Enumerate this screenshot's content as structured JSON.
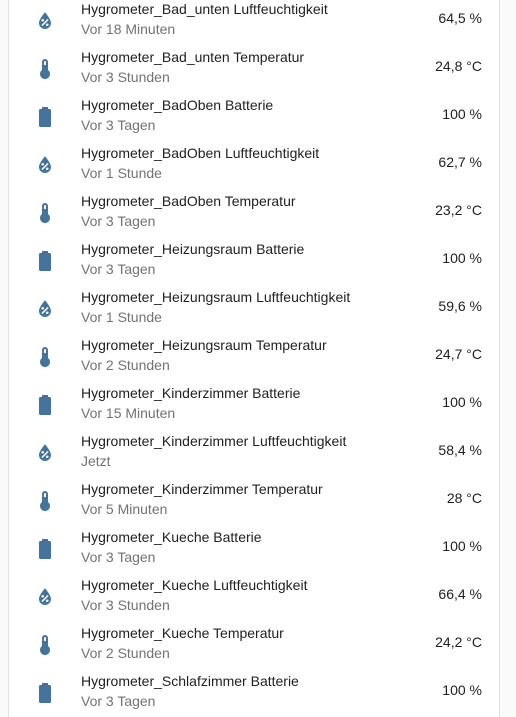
{
  "icon_color": "#44739e",
  "entities": [
    {
      "icon": "water-percent-icon",
      "name": "Hygrometer_Bad_unten Luftfeuchtigkeit",
      "time": "Vor 18 Minuten",
      "state": "64,5 %"
    },
    {
      "icon": "thermometer-icon",
      "name": "Hygrometer_Bad_unten Temperatur",
      "time": "Vor 3 Stunden",
      "state": "24,8 °C"
    },
    {
      "icon": "battery-icon",
      "name": "Hygrometer_BadOben Batterie",
      "time": "Vor 3 Tagen",
      "state": "100 %"
    },
    {
      "icon": "water-percent-icon",
      "name": "Hygrometer_BadOben Luftfeuchtigkeit",
      "time": "Vor 1 Stunde",
      "state": "62,7 %"
    },
    {
      "icon": "thermometer-icon",
      "name": "Hygrometer_BadOben Temperatur",
      "time": "Vor 3 Tagen",
      "state": "23,2 °C"
    },
    {
      "icon": "battery-icon",
      "name": "Hygrometer_Heizungsraum Batterie",
      "time": "Vor 3 Tagen",
      "state": "100 %"
    },
    {
      "icon": "water-percent-icon",
      "name": "Hygrometer_Heizungsraum Luftfeuchtigkeit",
      "time": "Vor 1 Stunde",
      "state": "59,6 %"
    },
    {
      "icon": "thermometer-icon",
      "name": "Hygrometer_Heizungsraum Temperatur",
      "time": "Vor 2 Stunden",
      "state": "24,7 °C"
    },
    {
      "icon": "battery-icon",
      "name": "Hygrometer_Kinderzimmer Batterie",
      "time": "Vor 15 Minuten",
      "state": "100 %"
    },
    {
      "icon": "water-percent-icon",
      "name": "Hygrometer_Kinderzimmer Luftfeuchtigkeit",
      "time": "Jetzt",
      "state": "58,4 %"
    },
    {
      "icon": "thermometer-icon",
      "name": "Hygrometer_Kinderzimmer Temperatur",
      "time": "Vor 5 Minuten",
      "state": "28 °C"
    },
    {
      "icon": "battery-icon",
      "name": "Hygrometer_Kueche Batterie",
      "time": "Vor 3 Tagen",
      "state": "100 %"
    },
    {
      "icon": "water-percent-icon",
      "name": "Hygrometer_Kueche Luftfeuchtigkeit",
      "time": "Vor 3 Stunden",
      "state": "66,4 %"
    },
    {
      "icon": "thermometer-icon",
      "name": "Hygrometer_Kueche Temperatur",
      "time": "Vor 2 Stunden",
      "state": "24,2 °C"
    },
    {
      "icon": "battery-icon",
      "name": "Hygrometer_Schlafzimmer Batterie",
      "time": "Vor 3 Tagen",
      "state": "100 %"
    }
  ]
}
